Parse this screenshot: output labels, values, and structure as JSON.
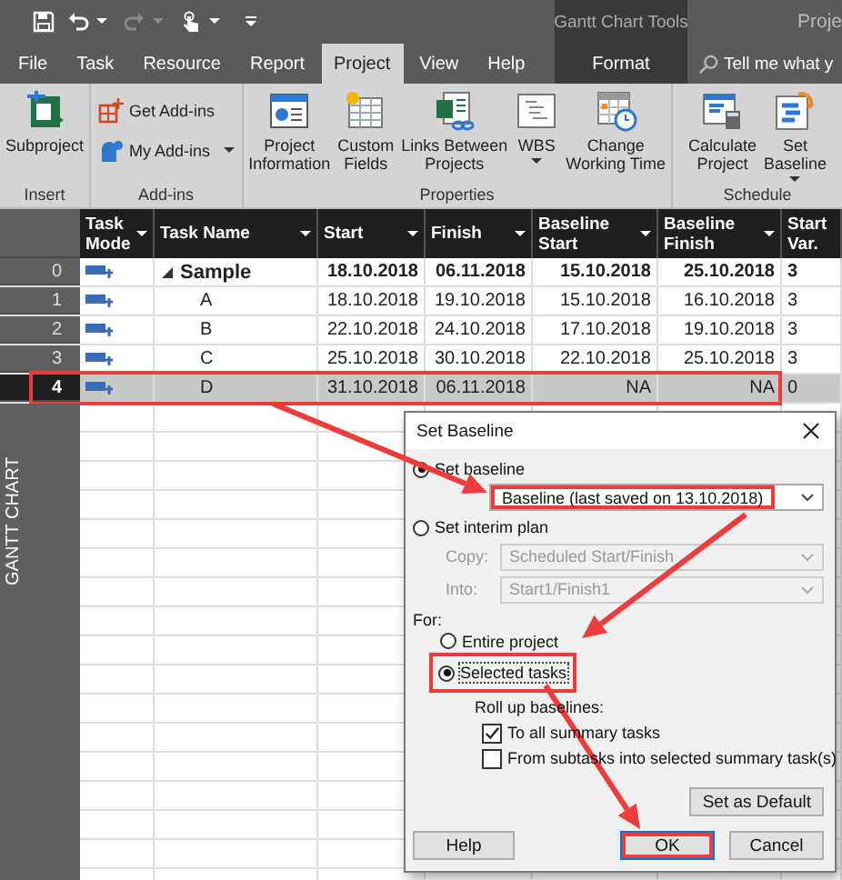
{
  "title_bar": {
    "context_title": "Gantt Chart Tools",
    "title": "Proje"
  },
  "tabs": [
    {
      "label": "File",
      "selected": false
    },
    {
      "label": "Task",
      "selected": false
    },
    {
      "label": "Resource",
      "selected": false
    },
    {
      "label": "Report",
      "selected": false
    },
    {
      "label": "Project",
      "selected": true
    },
    {
      "label": "View",
      "selected": false
    },
    {
      "label": "Help",
      "selected": false
    }
  ],
  "context_tabs": [
    {
      "label": "Format",
      "selected": false
    }
  ],
  "search": {
    "placeholder": "Tell me what y"
  },
  "ribbon": {
    "groups": [
      {
        "label": "Insert",
        "commands": [
          {
            "kind": "large",
            "label": "Subproject",
            "menu": false
          }
        ]
      },
      {
        "label": "Add-ins",
        "commands": [
          {
            "kind": "small",
            "label": "Get Add-ins",
            "menu": false
          },
          {
            "kind": "small",
            "label": "My Add-ins",
            "menu": true
          }
        ]
      },
      {
        "label": "Properties",
        "commands": [
          {
            "kind": "large",
            "label": "Project\nInformation",
            "menu": false
          },
          {
            "kind": "large",
            "label": "Custom\nFields",
            "menu": false
          },
          {
            "kind": "large",
            "label": "Links Between\nProjects",
            "menu": false
          },
          {
            "kind": "large",
            "label": "WBS",
            "menu": true
          },
          {
            "kind": "large",
            "label": "Change\nWorking Time",
            "menu": false
          }
        ]
      },
      {
        "label": "Schedule",
        "commands": [
          {
            "kind": "large",
            "label": "Calculate\nProject",
            "menu": false
          },
          {
            "kind": "large",
            "label": "Set\nBaseline",
            "menu": true
          }
        ]
      }
    ]
  },
  "view_bar": {
    "label": "GANTT CHART"
  },
  "table": {
    "columns": [
      {
        "label": "Task\nMode",
        "menu": true
      },
      {
        "label": "Task Name",
        "menu": true
      },
      {
        "label": "Start",
        "menu": true
      },
      {
        "label": "Finish",
        "menu": true
      },
      {
        "label": "Baseline\nStart",
        "menu": true
      },
      {
        "label": "Baseline\nFinish",
        "menu": true
      },
      {
        "label": "Start\nVar.",
        "menu": false
      }
    ],
    "rows": [
      {
        "id": "0",
        "name": "Sample",
        "start": "18.10.2018",
        "finish": "06.11.2018",
        "baseline_start": "15.10.2018",
        "baseline_finish": "25.10.2018",
        "start_var": "3",
        "selected": false,
        "highlighted": false,
        "children": [
          {
            "id": "1",
            "name": "A",
            "start": "18.10.2018",
            "finish": "19.10.2018",
            "baseline_start": "15.10.2018",
            "baseline_finish": "16.10.2018",
            "start_var": "3",
            "selected": false,
            "highlighted": false
          },
          {
            "id": "2",
            "name": "B",
            "start": "22.10.2018",
            "finish": "24.10.2018",
            "baseline_start": "17.10.2018",
            "baseline_finish": "19.10.2018",
            "start_var": "3",
            "selected": false,
            "highlighted": false
          },
          {
            "id": "3",
            "name": "C",
            "start": "25.10.2018",
            "finish": "30.10.2018",
            "baseline_start": "22.10.2018",
            "baseline_finish": "25.10.2018",
            "start_var": "3",
            "selected": false,
            "highlighted": false
          },
          {
            "id": "4",
            "name": "D",
            "start": "31.10.2018",
            "finish": "06.11.2018",
            "baseline_start": "NA",
            "baseline_finish": "NA",
            "start_var": "0",
            "selected": true,
            "highlighted": true
          }
        ]
      }
    ]
  },
  "dialog": {
    "title": "Set Baseline",
    "baseline_option": {
      "label": "Set baseline",
      "selected": true
    },
    "baseline_dropdown": {
      "value": "Baseline (last saved on 13.10.2018)",
      "highlighted": true
    },
    "interim_option": {
      "label": "Set interim plan",
      "selected": false
    },
    "interim_fields": [
      {
        "label": "Copy:",
        "value": "Scheduled Start/Finish",
        "disabled": true
      },
      {
        "label": "Into:",
        "value": "Start1/Finish1",
        "disabled": true
      }
    ],
    "for_label": "For:",
    "scope_options": [
      {
        "label": "Entire project",
        "selected": false,
        "highlighted": false
      },
      {
        "label": "Selected tasks",
        "selected": true,
        "highlighted": true
      }
    ],
    "rollup_label": "Roll up baselines:",
    "rollup_options": [
      {
        "label": "To all summary tasks",
        "checked": true
      },
      {
        "label": "From subtasks into selected summary task(s)",
        "checked": false
      }
    ],
    "default_button": "Set as Default",
    "buttons": [
      {
        "label": "Help",
        "default": false,
        "highlighted": false
      },
      {
        "label": "OK",
        "default": true,
        "highlighted": true
      },
      {
        "label": "Cancel",
        "default": false,
        "highlighted": false
      }
    ]
  }
}
